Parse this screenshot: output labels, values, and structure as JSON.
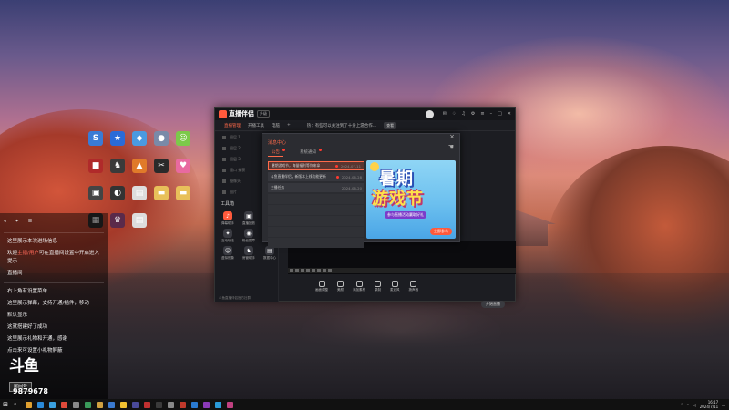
{
  "desktop": {
    "icons": [
      {
        "label": "",
        "color": "#3a7bd5",
        "glyph": "S"
      },
      {
        "label": "",
        "color": "#2a6bd8",
        "glyph": "★"
      },
      {
        "label": "",
        "color": "#4a9ae0",
        "glyph": "◆"
      },
      {
        "label": "",
        "color": "#7a8aa8",
        "glyph": "●"
      },
      {
        "label": "",
        "color": "#7cc94a",
        "glyph": "☺"
      },
      {
        "label": "",
        "color": "#b02a2a",
        "glyph": "■"
      },
      {
        "label": "",
        "color": "#3a3a3a",
        "glyph": "♞"
      },
      {
        "label": "",
        "color": "#e07a2a",
        "glyph": "▲"
      },
      {
        "label": "",
        "color": "#2a2a2a",
        "glyph": "✂"
      },
      {
        "label": "",
        "color": "#e86aa0",
        "glyph": "♥"
      },
      {
        "label": "",
        "color": "#444",
        "glyph": "▣"
      },
      {
        "label": "",
        "color": "#333",
        "glyph": "◐"
      },
      {
        "label": "",
        "color": "#ddd",
        "glyph": "▤"
      },
      {
        "label": "",
        "color": "#e8c05a",
        "glyph": "▬"
      },
      {
        "label": "",
        "color": "#e8c05a",
        "glyph": "▬"
      },
      {
        "label": "",
        "color": "#2a2a2a",
        "glyph": "▦"
      },
      {
        "label": "",
        "color": "#5a2a4a",
        "glyph": "♛"
      },
      {
        "label": "",
        "color": "#ddd",
        "glyph": "▤"
      }
    ]
  },
  "chat": {
    "messages": [
      {
        "text": "这里展示本次进场信息"
      },
      {
        "prefix": "欢迎",
        "highlight": "主播/用户",
        "suffix": "可在直播间设置中开启进入提示"
      },
      {
        "text": "直播间"
      }
    ],
    "tips": [
      "右上角有设置菜单",
      "这里展示弹幕，支持开通/插件，移动",
      "默认显示",
      "这就搭建好了成功",
      "这里展示礼物和开通，感谢",
      "点击来可设置小礼物屏蔽"
    ],
    "logo_text": "斗鱼",
    "logo_tag": "房间号",
    "room_number": "9879678"
  },
  "app": {
    "title": "直播伴侣",
    "version": "升级",
    "tabs": [
      "直播管理",
      "开播工具",
      "电脑"
    ],
    "active_tab": 0,
    "notice": "热：有些可以关注到了十分上游合作...",
    "notice_button": "查看",
    "sidebar_rows": [
      "图层 1",
      "图层 2",
      "图层 3",
      "窗口 捕获",
      "摄像头",
      "图片"
    ],
    "tools_title": "工具箱",
    "tools": [
      {
        "label": "弹幕助手",
        "color": "#ff5a3c",
        "glyph": "♪"
      },
      {
        "label": "直播回放",
        "color": "#3a3b42",
        "glyph": "▣"
      },
      {
        "label": "",
        "color": "#3a3b42",
        "glyph": ""
      },
      {
        "label": "互动玩法",
        "color": "#3a3b42",
        "glyph": "✦"
      },
      {
        "label": "粉丝勋章",
        "color": "#3a3b42",
        "glyph": "◉"
      },
      {
        "label": "直播任务",
        "color": "#ff5a3c",
        "glyph": "▲"
      },
      {
        "label": "虚拟形象",
        "color": "#3a3b42",
        "glyph": "☺"
      },
      {
        "label": "房管助手",
        "color": "#3a3b42",
        "glyph": "♞"
      },
      {
        "label": "数据中心",
        "color": "#3a3b42",
        "glyph": "▤"
      }
    ],
    "footer": "斗鱼直播伴侣官方社群",
    "bottom_tools": [
      "画面调整",
      "美颜",
      "添加素材",
      "录制",
      "麦克风",
      "扬声器"
    ],
    "start_button": "开始直播"
  },
  "popup": {
    "title": "消息中心",
    "close": "×",
    "tabs": [
      {
        "label": "公告",
        "active": true,
        "dot": true
      },
      {
        "label": "系统通知",
        "active": false,
        "dot": true
      }
    ],
    "items": [
      {
        "text": "暑期游戏节，海量福利等你来拿",
        "date": "2024-07-11",
        "active": true,
        "dot": true
      },
      {
        "text": "斗鱼直播伴侣，新版本上线功能更新",
        "date": "2024-06-28",
        "active": false,
        "dot": true
      },
      {
        "text": "主播任务",
        "date": "2024-06-20",
        "active": false,
        "dot": false
      }
    ],
    "banner": {
      "title_line1": "暑期",
      "title_line2": "游戏节",
      "subtitle": "参与直播活动赢取好礼",
      "button": "立即参与"
    }
  },
  "taskbar": {
    "apps": [
      "#e0a030",
      "#2a8ad8",
      "#3aa0e0",
      "#e04a3a",
      "#8a8a8a",
      "#3a9a5a",
      "#d0a040",
      "#3a7ad0",
      "#f0c030",
      "#4a4a9a",
      "#c03030",
      "#3a3a3a",
      "#888",
      "#c0392b",
      "#2a7ad0",
      "#8a3ab8",
      "#2a9ad8",
      "#c04080"
    ],
    "time": "16:17",
    "date": "2024/7/11",
    "colors": {
      "accent": "#ff6a4a"
    }
  }
}
